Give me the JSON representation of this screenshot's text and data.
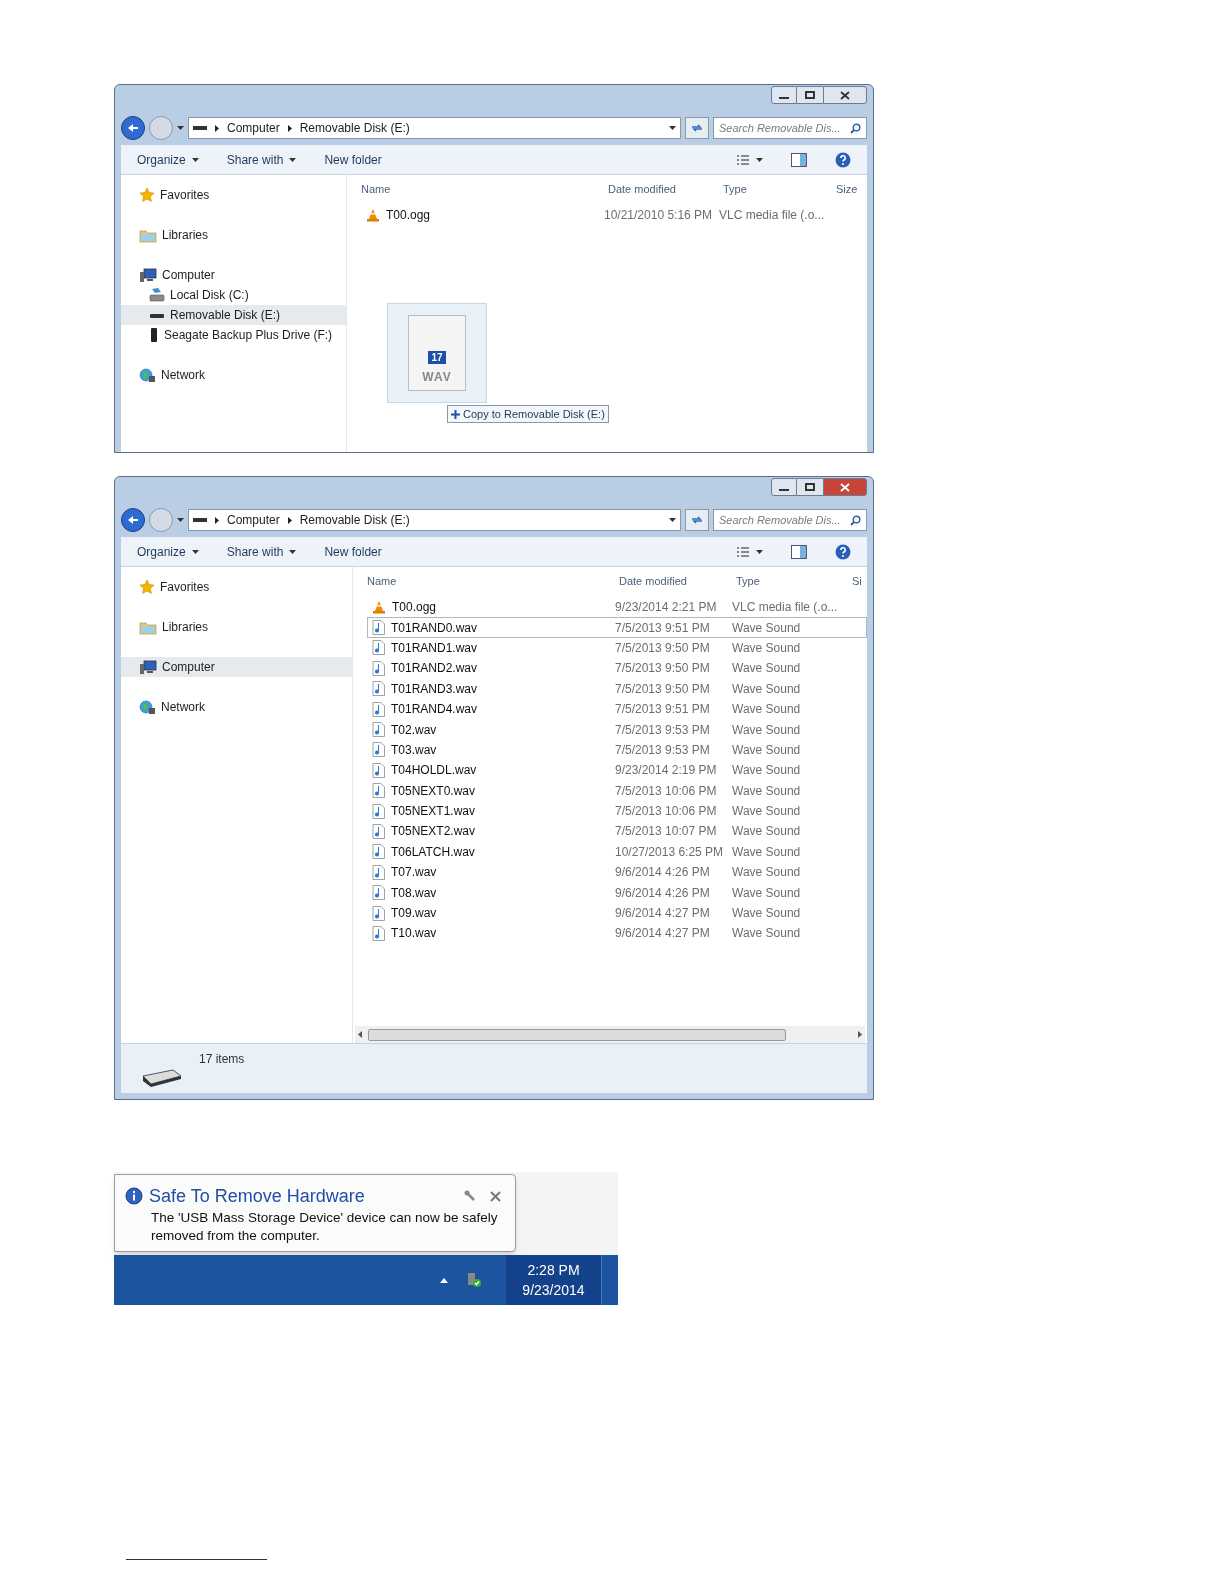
{
  "windows": [
    {
      "breadcrumb": [
        "Computer",
        "Removable Disk (E:)"
      ],
      "search": {
        "placeholder": "Search Removable Dis..."
      },
      "toolbar": [
        "Organize",
        "Share with",
        "New folder"
      ],
      "sidebar": [
        {
          "kind": "favorites",
          "label": "Favorites",
          "selected": false
        },
        {
          "kind": "libraries",
          "label": "Libraries",
          "selected": false
        },
        {
          "kind": "computer",
          "label": "Computer",
          "selected": false,
          "children": [
            {
              "kind": "localdisk",
              "label": "Local Disk (C:)",
              "selected": false
            },
            {
              "kind": "removable",
              "label": "Removable Disk (E:)",
              "selected": true
            },
            {
              "kind": "drive",
              "label": "Seagate Backup Plus Drive (F:)",
              "selected": false
            }
          ]
        },
        {
          "kind": "network",
          "label": "Network",
          "selected": false
        }
      ],
      "columns": [
        "Name",
        "Date modified",
        "Type",
        "Size"
      ],
      "rows": [
        {
          "kind": "ogg",
          "name": "T00.ogg",
          "date": "10/21/2010 5:16 PM",
          "type": "VLC media file (.o...",
          "focused": false
        }
      ],
      "drag": {
        "badge": "17",
        "label": "WAV",
        "tooltip": "Copy to Removable Disk (E:)"
      }
    },
    {
      "breadcrumb": [
        "Computer",
        "Removable Disk (E:)"
      ],
      "search": {
        "placeholder": "Search Removable Dis..."
      },
      "toolbar": [
        "Organize",
        "Share with",
        "New folder"
      ],
      "sidebar": [
        {
          "kind": "favorites",
          "label": "Favorites",
          "selected": false
        },
        {
          "kind": "libraries",
          "label": "Libraries",
          "selected": false
        },
        {
          "kind": "computer",
          "label": "Computer",
          "selected": true
        },
        {
          "kind": "network",
          "label": "Network",
          "selected": false
        }
      ],
      "columns": [
        "Name",
        "Date modified",
        "Type",
        "Si"
      ],
      "rows": [
        {
          "kind": "ogg",
          "name": "T00.ogg",
          "date": "9/23/2014 2:21 PM",
          "type": "VLC media file (.o...",
          "focused": false
        },
        {
          "kind": "wav",
          "name": "T01RAND0.wav",
          "date": "7/5/2013 9:51 PM",
          "type": "Wave Sound",
          "focused": true
        },
        {
          "kind": "wav",
          "name": "T01RAND1.wav",
          "date": "7/5/2013 9:50 PM",
          "type": "Wave Sound",
          "focused": false
        },
        {
          "kind": "wav",
          "name": "T01RAND2.wav",
          "date": "7/5/2013 9:50 PM",
          "type": "Wave Sound",
          "focused": false
        },
        {
          "kind": "wav",
          "name": "T01RAND3.wav",
          "date": "7/5/2013 9:50 PM",
          "type": "Wave Sound",
          "focused": false
        },
        {
          "kind": "wav",
          "name": "T01RAND4.wav",
          "date": "7/5/2013 9:51 PM",
          "type": "Wave Sound",
          "focused": false
        },
        {
          "kind": "wav",
          "name": "T02.wav",
          "date": "7/5/2013 9:53 PM",
          "type": "Wave Sound",
          "focused": false
        },
        {
          "kind": "wav",
          "name": "T03.wav",
          "date": "7/5/2013 9:53 PM",
          "type": "Wave Sound",
          "focused": false
        },
        {
          "kind": "wav",
          "name": "T04HOLDL.wav",
          "date": "9/23/2014 2:19 PM",
          "type": "Wave Sound",
          "focused": false
        },
        {
          "kind": "wav",
          "name": "T05NEXT0.wav",
          "date": "7/5/2013 10:06 PM",
          "type": "Wave Sound",
          "focused": false
        },
        {
          "kind": "wav",
          "name": "T05NEXT1.wav",
          "date": "7/5/2013 10:06 PM",
          "type": "Wave Sound",
          "focused": false
        },
        {
          "kind": "wav",
          "name": "T05NEXT2.wav",
          "date": "7/5/2013 10:07 PM",
          "type": "Wave Sound",
          "focused": false
        },
        {
          "kind": "wav",
          "name": "T06LATCH.wav",
          "date": "10/27/2013 6:25 PM",
          "type": "Wave Sound",
          "focused": false
        },
        {
          "kind": "wav",
          "name": "T07.wav",
          "date": "9/6/2014 4:26 PM",
          "type": "Wave Sound",
          "focused": false
        },
        {
          "kind": "wav",
          "name": "T08.wav",
          "date": "9/6/2014 4:26 PM",
          "type": "Wave Sound",
          "focused": false
        },
        {
          "kind": "wav",
          "name": "T09.wav",
          "date": "9/6/2014 4:27 PM",
          "type": "Wave Sound",
          "focused": false
        },
        {
          "kind": "wav",
          "name": "T10.wav",
          "date": "9/6/2014 4:27 PM",
          "type": "Wave Sound",
          "focused": false
        }
      ],
      "status": "17 items"
    }
  ],
  "notification": {
    "title": "Safe To Remove Hardware",
    "message": "The 'USB Mass Storage Device' device can now be safely removed from the computer.",
    "time": "2:28 PM",
    "date": "9/23/2014"
  }
}
